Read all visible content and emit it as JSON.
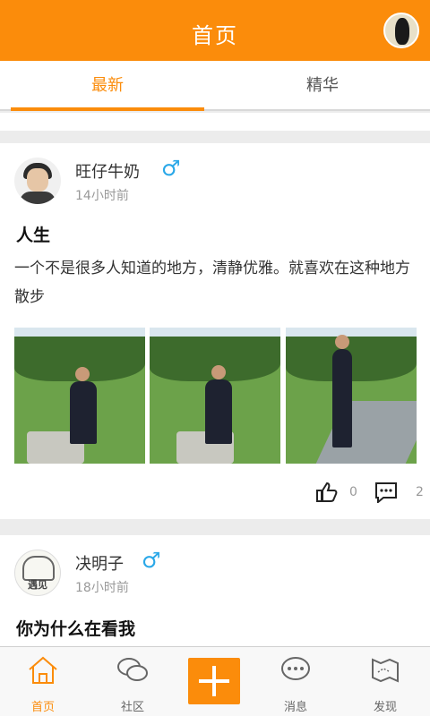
{
  "header": {
    "title": "首页"
  },
  "tabs": [
    {
      "label": "最新",
      "active": true
    },
    {
      "label": "精华",
      "active": false
    }
  ],
  "posts": [
    {
      "author": "旺仔牛奶",
      "gender_symbol": "♂",
      "time": "14小时前",
      "title": "人生",
      "body": "一个不是很多人知道的地方，清静优雅。就喜欢在这种地方散步",
      "likes": "0",
      "comments": "2"
    },
    {
      "author": "决明子",
      "gender_symbol": "♂",
      "time": "18小时前",
      "title": "你为什么在看我",
      "avatar_text": "遇见"
    }
  ],
  "nav": [
    {
      "label": "首页",
      "icon": "home-icon",
      "active": true
    },
    {
      "label": "社区",
      "icon": "community-icon",
      "active": false
    },
    {
      "label": "",
      "icon": "add-icon",
      "active": false
    },
    {
      "label": "消息",
      "icon": "message-icon",
      "active": false
    },
    {
      "label": "发现",
      "icon": "discover-icon",
      "active": false
    }
  ],
  "colors": {
    "accent": "#fb8c0b",
    "male": "#2aa8e8"
  }
}
